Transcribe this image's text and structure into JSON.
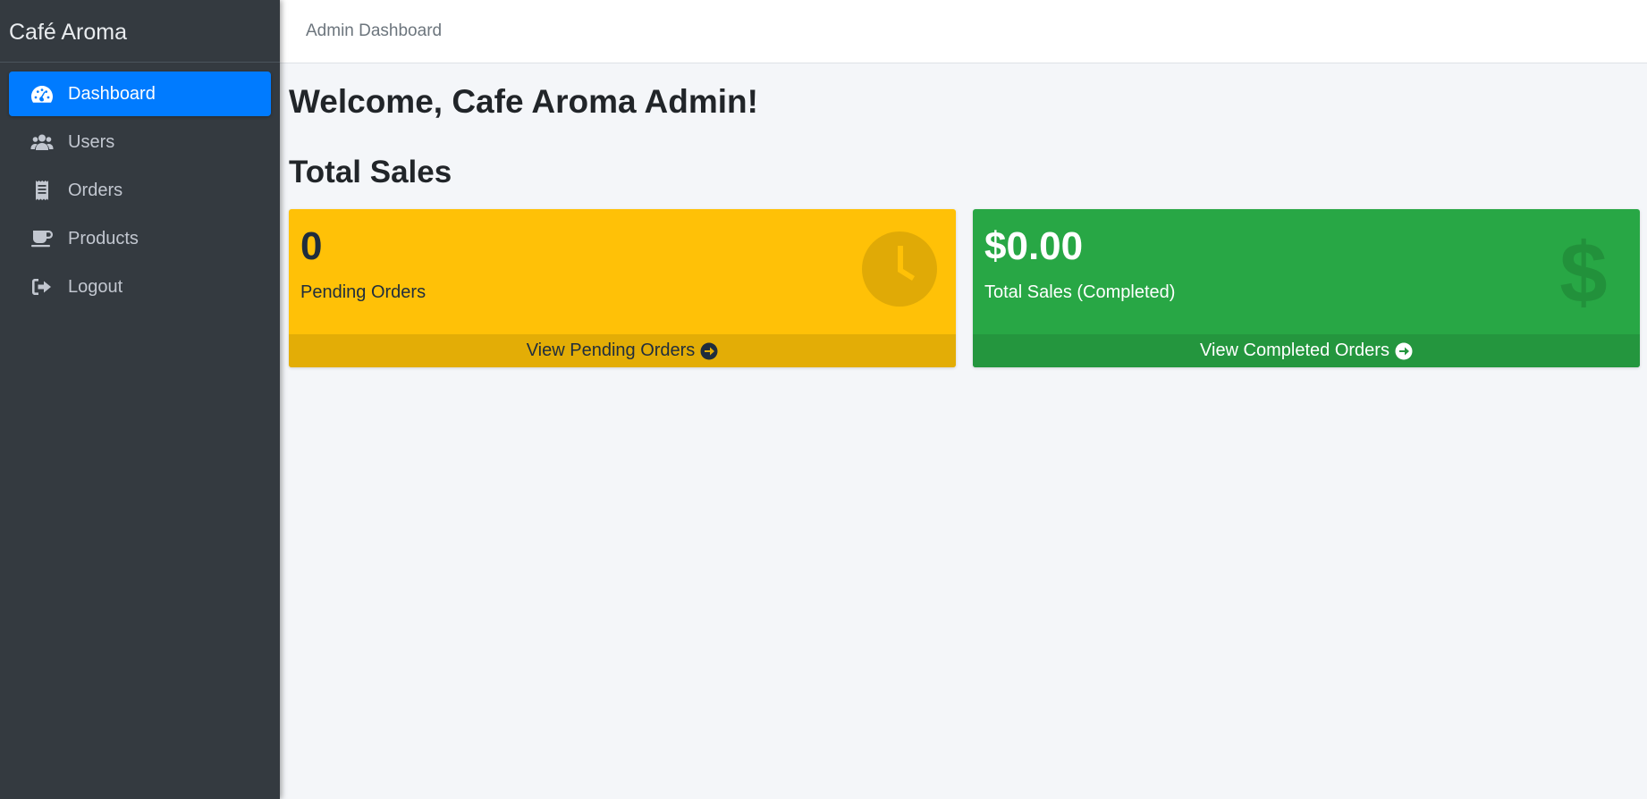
{
  "sidebar": {
    "brand": "Café Aroma",
    "items": [
      {
        "label": "Dashboard",
        "icon": "tachometer-icon",
        "active": true
      },
      {
        "label": "Users",
        "icon": "users-icon",
        "active": false
      },
      {
        "label": "Orders",
        "icon": "receipt-icon",
        "active": false
      },
      {
        "label": "Products",
        "icon": "coffee-icon",
        "active": false
      },
      {
        "label": "Logout",
        "icon": "sign-out-icon",
        "active": false
      }
    ]
  },
  "header": {
    "title": "Admin Dashboard"
  },
  "main": {
    "welcome": "Welcome, Cafe Aroma Admin!",
    "section_title": "Total Sales",
    "cards": [
      {
        "value": "0",
        "label": "Pending Orders",
        "footer": "View Pending Orders",
        "icon": "clock-icon",
        "color": "#ffc107"
      },
      {
        "value": "$0.00",
        "label": "Total Sales (Completed)",
        "footer": "View Completed Orders",
        "icon": "dollar-icon",
        "color": "#28a745"
      }
    ]
  },
  "colors": {
    "sidebar_bg": "#343a40",
    "accent": "#007bff",
    "warning": "#ffc107",
    "success": "#28a745",
    "page_bg": "#f4f6f9"
  }
}
